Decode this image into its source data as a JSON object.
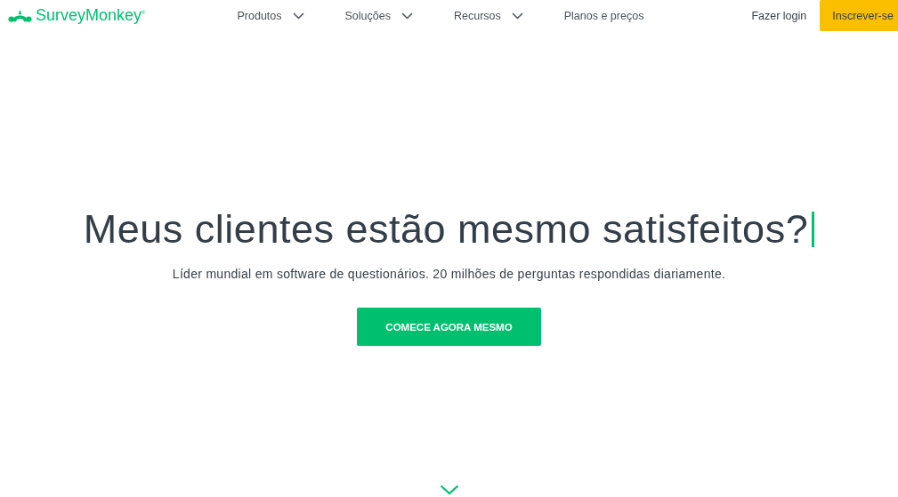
{
  "header": {
    "logo": "SurveyMonkey$^{®}$",
    "nav": [
      {
        "label": "Produtos",
        "has_menu": true
      },
      {
        "label": "Soluções",
        "has_menu": true
      },
      {
        "label": "Recursos",
        "has_menu": true
      },
      {
        "label": "Planos e preços",
        "has_menu": false
      }
    ],
    "login": "Fazer login",
    "signup": "Inscrever-se"
  },
  "hero": {
    "title": "Meus clientes estão mesmo satisfeitos?",
    "subtitle": "Líder mundial em software de questionários. 20 milhões de perguntas respondidas diariamente.",
    "cta": "COMECE AGORA MESMO"
  }
}
